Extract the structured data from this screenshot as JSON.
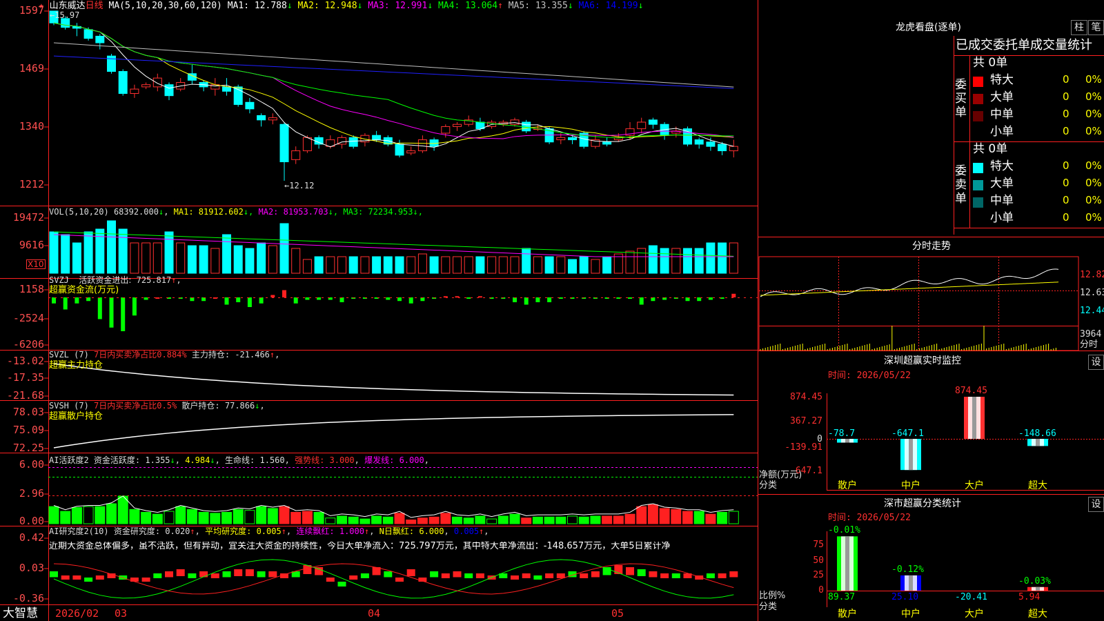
{
  "header": {
    "stock_name": "山东威达",
    "period": "日线",
    "ma_spec": "MA(5,10,20,30,60,120)",
    "ma": [
      {
        "label": "MA1:",
        "value": "12.788",
        "arrow": "↓",
        "color": "#ffffff"
      },
      {
        "label": "MA2:",
        "value": "12.948",
        "arrow": "↓",
        "color": "#ffff00"
      },
      {
        "label": "MA3:",
        "value": "12.991",
        "arrow": "↓",
        "color": "#ff00ff"
      },
      {
        "label": "MA4:",
        "value": "13.064",
        "arrow": "↑",
        "color": "#00ff00"
      },
      {
        "label": "MA5:",
        "value": "13.355",
        "arrow": "↓",
        "color": "#c0c0c0"
      },
      {
        "label": "MA6:",
        "value": "14.199",
        "arrow": "↓",
        "color": "#0000ff"
      }
    ],
    "high_mark": "←15.97",
    "low_mark": "←12.12"
  },
  "price_axis": [
    "1597",
    "1469",
    "1340",
    "1212"
  ],
  "vol": {
    "spec": "VOL(5,10,20)",
    "value": "68392.000",
    "ma": [
      {
        "label": "MA1:",
        "value": "81912.602",
        "color": "#ffff00"
      },
      {
        "label": "MA2:",
        "value": "81953.703",
        "color": "#ff00ff"
      },
      {
        "label": "MA3:",
        "value": "72234.953",
        "color": "#00ff00"
      }
    ],
    "axis": [
      "19472",
      "9616"
    ],
    "unit": "X10"
  },
  "svzj": {
    "name": "SVZJ",
    "title": "活跃资金进出:",
    "value": "725.817",
    "arrow": "↑",
    "sub": "超赢资金流(万元)",
    "axis": [
      "1158",
      "-2524",
      "-6206"
    ]
  },
  "svzl": {
    "name": "SVZL (7)",
    "t1": "7日内买卖净占比",
    "v1": "0.884%",
    "t2": "主力持仓:",
    "v2": "-21.466",
    "arrow": "↑",
    "sub": "超赢主力持仓",
    "axis": [
      "-13.02",
      "-17.35",
      "-21.68"
    ]
  },
  "svsh": {
    "name": "SVSH (7)",
    "t1": "7日内买卖净占比",
    "v1": "0.5%",
    "t2": "散户持仓:",
    "v2": "77.866",
    "arrow": "↓",
    "sub": "超赢散户持仓",
    "axis": [
      "78.03",
      "75.09",
      "72.25"
    ]
  },
  "ai1": {
    "name": "AI活跃度2",
    "t1": "资金活跃度:",
    "v1": "1.355",
    "v1b": "4.984",
    "t2": "生命线:",
    "v2": "1.560",
    "t3": "强势线:",
    "v3": "3.000",
    "t4": "爆发线:",
    "v4": "6.000",
    "axis": [
      "6.00",
      "2.96",
      "0.00"
    ]
  },
  "ai2": {
    "name": "AI研究度2(10)",
    "t1": "资金研究度:",
    "v1": "0.020",
    "t2": "平均研究度:",
    "v2": "0.005",
    "t3": "连续飘红:",
    "v3": "1.000",
    "t4": "N日飘红:",
    "v4": "6.000",
    "v5": "0.005",
    "comment": "近期大资金总体偏多，虽不活跃，但有异动，宜关注大资金的持续性，今日大单净流入：725.797万元，其中特大单净流出：-148.657万元，大单5日累计净",
    "axis": [
      "0.42",
      "0.03",
      "-0.36"
    ]
  },
  "dates": [
    "2026/02",
    "03",
    "04",
    "05"
  ],
  "footer_brand": "大智慧",
  "right": {
    "longhu": {
      "title": "龙虎看盘(逐单)",
      "btn1": "柱",
      "btn2": "笔",
      "stat_title": "已成交委托单成交量统计",
      "buy": {
        "side": "委买单",
        "total": "共 0单",
        "rows": [
          {
            "label": "特大",
            "count": "0",
            "pct": "0%",
            "color": "#ff0000"
          },
          {
            "label": "大单",
            "count": "0",
            "pct": "0%",
            "color": "#990000"
          },
          {
            "label": "中单",
            "count": "0",
            "pct": "0%",
            "color": "#660000"
          },
          {
            "label": "小单",
            "count": "0",
            "pct": "0%",
            "color": "#000000"
          }
        ]
      },
      "sell": {
        "side": "委卖单",
        "total": "共 0单",
        "rows": [
          {
            "label": "特大",
            "count": "0",
            "pct": "0%",
            "color": "#00ffff"
          },
          {
            "label": "大单",
            "count": "0",
            "pct": "0%",
            "color": "#009999"
          },
          {
            "label": "中单",
            "count": "0",
            "pct": "0%",
            "color": "#006666"
          },
          {
            "label": "小单",
            "count": "0",
            "pct": "0%",
            "color": "#000000"
          }
        ]
      }
    },
    "intraday": {
      "title": "分时走势",
      "axis": [
        "12.82",
        "12.63",
        "12.44"
      ],
      "vol_max": "3964",
      "vol_unit": "分时"
    },
    "realtime": {
      "title": "深圳超赢实时监控",
      "btn": "设",
      "time": "时间: 2026/05/22",
      "axis": [
        "874.45",
        "367.27",
        "0",
        "-139.91",
        "-647.1"
      ],
      "ylabel": "净额(万元)",
      "xlabel": "分类",
      "bars": [
        {
          "cat": "散户",
          "value": -78.7,
          "label": "-78.7"
        },
        {
          "cat": "中户",
          "value": -647.1,
          "label": "-647.1"
        },
        {
          "cat": "大户",
          "value": 874.45,
          "label": "874.45"
        },
        {
          "cat": "超大",
          "value": -148.66,
          "label": "-148.66"
        }
      ]
    },
    "classify": {
      "title": "深市超赢分类统计",
      "btn": "设",
      "time": "时间: 2026/05/22",
      "axis": [
        "75",
        "50",
        "25",
        "0"
      ],
      "ylabel": "比例%",
      "xlabel": "分类",
      "bars": [
        {
          "cat": "散户",
          "value": 89.37,
          "pct": "-0.01%",
          "label": "89.37"
        },
        {
          "cat": "中户",
          "value": 25.1,
          "pct": "-0.12%",
          "label": "25.10"
        },
        {
          "cat": "大户",
          "value": -20.41,
          "pct": "",
          "label": "-20.41"
        },
        {
          "cat": "超大",
          "value": 5.94,
          "pct": "-0.03%",
          "label": "5.94"
        }
      ]
    }
  }
}
